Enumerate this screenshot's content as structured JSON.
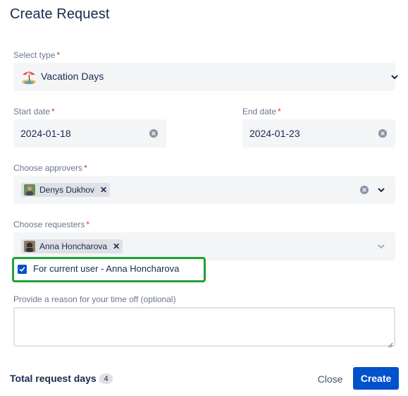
{
  "title": "Create Request",
  "type_field": {
    "label": "Select type",
    "value": "Vacation Days",
    "icon": "beach-umbrella-icon"
  },
  "start_date": {
    "label": "Start date",
    "value": "2024-01-18"
  },
  "end_date": {
    "label": "End date",
    "value": "2024-01-23"
  },
  "approvers": {
    "label": "Choose approvers",
    "selected": [
      "Denys Dukhov"
    ]
  },
  "requesters": {
    "label": "Choose requesters",
    "selected": [
      "Anna Honcharova"
    ]
  },
  "current_user_checkbox": {
    "label": "For current user - Anna Honcharova",
    "checked": true
  },
  "reason": {
    "label": "Provide a reason for your time off (optional)",
    "value": ""
  },
  "footer": {
    "total_label": "Total request days :",
    "total_value": "4",
    "close_label": "Close",
    "create_label": "Create"
  },
  "colors": {
    "primary": "#0052cc",
    "highlight": "#21a135",
    "required": "#de350b"
  }
}
